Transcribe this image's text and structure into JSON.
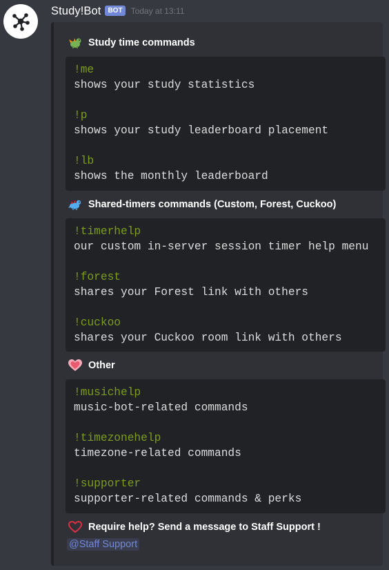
{
  "message": {
    "username": "Study!Bot",
    "bot_tag": "BOT",
    "timestamp": "Today at 13:11",
    "avatar_icon": "network-nodes-icon"
  },
  "embed": {
    "sections": [
      {
        "emoji": "dragon-icon",
        "title": "Study time commands",
        "commands": [
          {
            "cmd": "!me",
            "desc": "shows your study statistics"
          },
          {
            "cmd": "!p",
            "desc": "shows your study leaderboard placement"
          },
          {
            "cmd": "!lb",
            "desc": "shows the monthly leaderboard"
          }
        ]
      },
      {
        "emoji": "dino-icon",
        "title": "Shared-timers commands (Custom, Forest, Cuckoo)",
        "commands": [
          {
            "cmd": "!timerhelp",
            "desc": "our custom in-server session timer help menu"
          },
          {
            "cmd": "!forest",
            "desc": "shares your Forest link with others"
          },
          {
            "cmd": "!cuckoo",
            "desc": "shares your Cuckoo room link with others"
          }
        ]
      },
      {
        "emoji": "pink-heart-icon",
        "title": "Other",
        "commands": [
          {
            "cmd": "!musichelp",
            "desc": "music-bot-related commands"
          },
          {
            "cmd": "!timezonehelp",
            "desc": "timezone-related commands"
          },
          {
            "cmd": "!supporter",
            "desc": "supporter-related commands & perks"
          }
        ]
      }
    ],
    "footer": {
      "emoji": "heart-outline-icon",
      "text": "Require help? Send a message to Staff Support !",
      "mention": "@Staff Support"
    }
  },
  "colors": {
    "background": "#36393f",
    "embed_bg": "#2f3136",
    "code_bg": "#202225",
    "command": "#7c9d1e",
    "text": "#dcddde",
    "bot_tag": "#7289da",
    "mention": "#7289da"
  }
}
